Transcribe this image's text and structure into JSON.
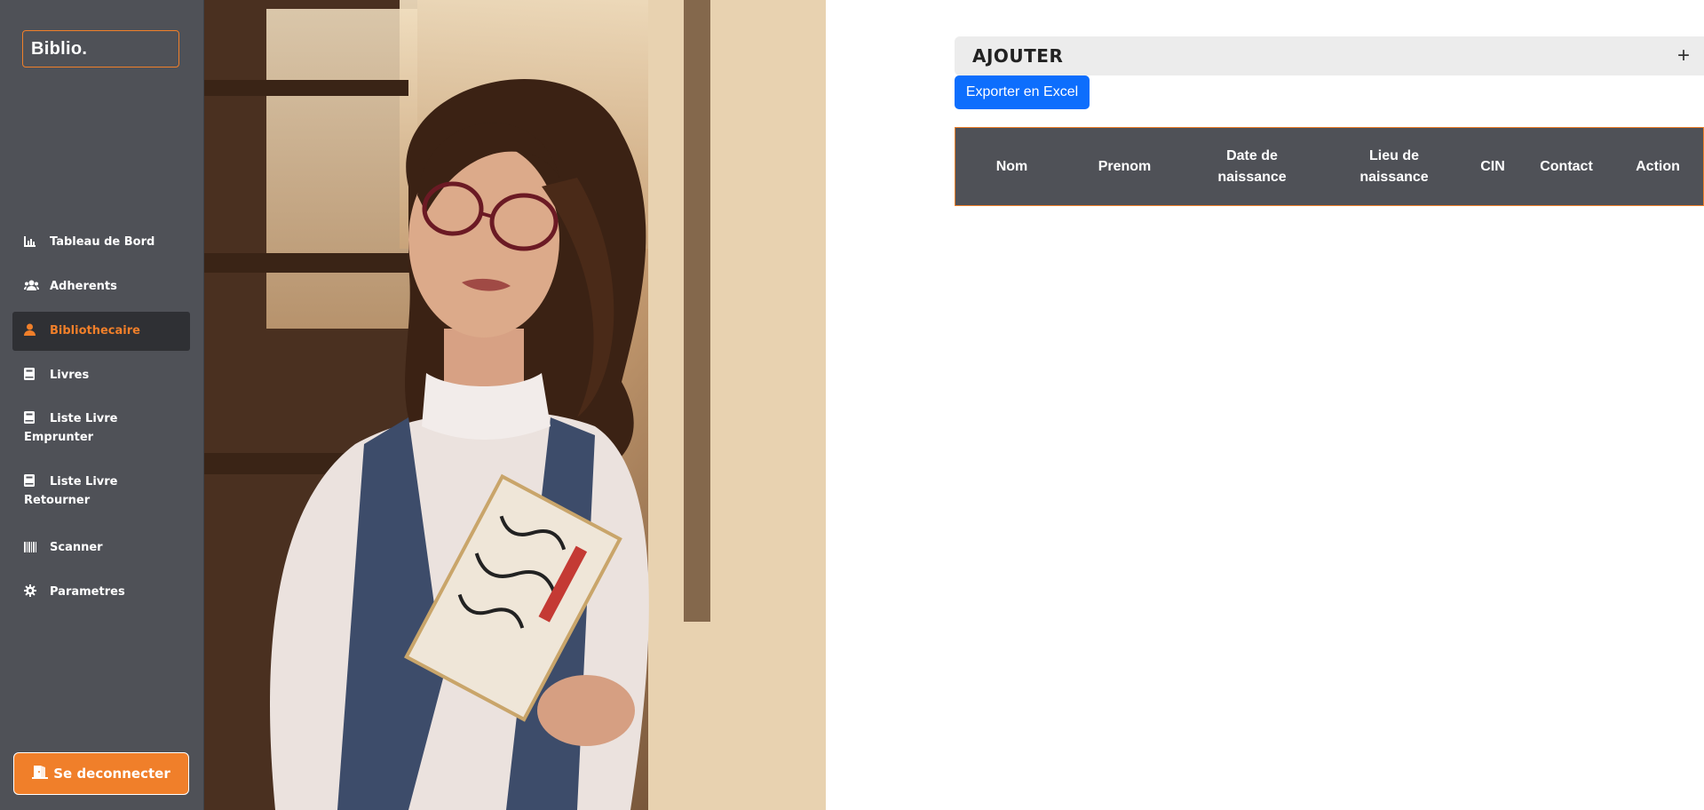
{
  "app": {
    "logo": "Biblio."
  },
  "sidebar": {
    "items": [
      {
        "label": "Tableau de Bord",
        "icon": "chart-icon"
      },
      {
        "label": "Adherents",
        "icon": "users-icon"
      },
      {
        "label": "Bibliothecaire",
        "icon": "user-icon",
        "active": true
      },
      {
        "label": "Livres",
        "icon": "book-icon"
      },
      {
        "label": "Liste Livre Emprunter",
        "icon": "book-icon"
      },
      {
        "label": "Liste Livre Retourner",
        "icon": "book-icon"
      },
      {
        "label": "Scanner",
        "icon": "barcode-icon"
      },
      {
        "label": "Parametres",
        "icon": "gear-icon"
      }
    ],
    "logout_label": "Se deconnecter"
  },
  "main": {
    "ajouter_label": "AJOUTER",
    "plus_symbol": "+",
    "export_label": "Exporter en Excel",
    "table": {
      "headers": [
        "Nom",
        "Prenom",
        "Date de naissance",
        "Lieu de naissance",
        "CIN",
        "Contact",
        "Action"
      ]
    }
  },
  "colors": {
    "accent": "#f07f2a",
    "sidebar": "#4f5157",
    "primary_button": "#0d6efd"
  }
}
